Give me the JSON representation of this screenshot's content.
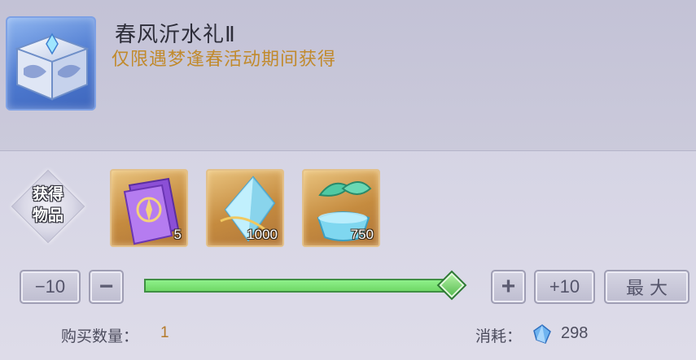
{
  "package": {
    "title": "春风沂水礼Ⅱ",
    "subtitle": "仅限遇梦逢春活动期间获得",
    "icon": "crystal-chest-icon"
  },
  "rewards": {
    "label": "获得物品",
    "items": [
      {
        "icon": "purple-ticket-icon",
        "count": "5"
      },
      {
        "icon": "crystal-shard-icon",
        "count": "1000"
      },
      {
        "icon": "jade-leaf-vial-icon",
        "count": "750"
      }
    ]
  },
  "controls": {
    "minus10": "−10",
    "minus": "−",
    "plus": "+",
    "plus10": "+10",
    "max": "最 大"
  },
  "slider": {
    "value_fraction": 1.0
  },
  "footer": {
    "quantity_label": "购买数量：",
    "quantity_value": "1",
    "cost_label": "消耗：",
    "cost_icon": "blue-crystal-currency-icon",
    "cost_value": "298"
  },
  "colors": {
    "accent_gold": "#c18a2c",
    "slider_green": "#7ddf75",
    "panel_lavender": "#c9c8dc"
  }
}
